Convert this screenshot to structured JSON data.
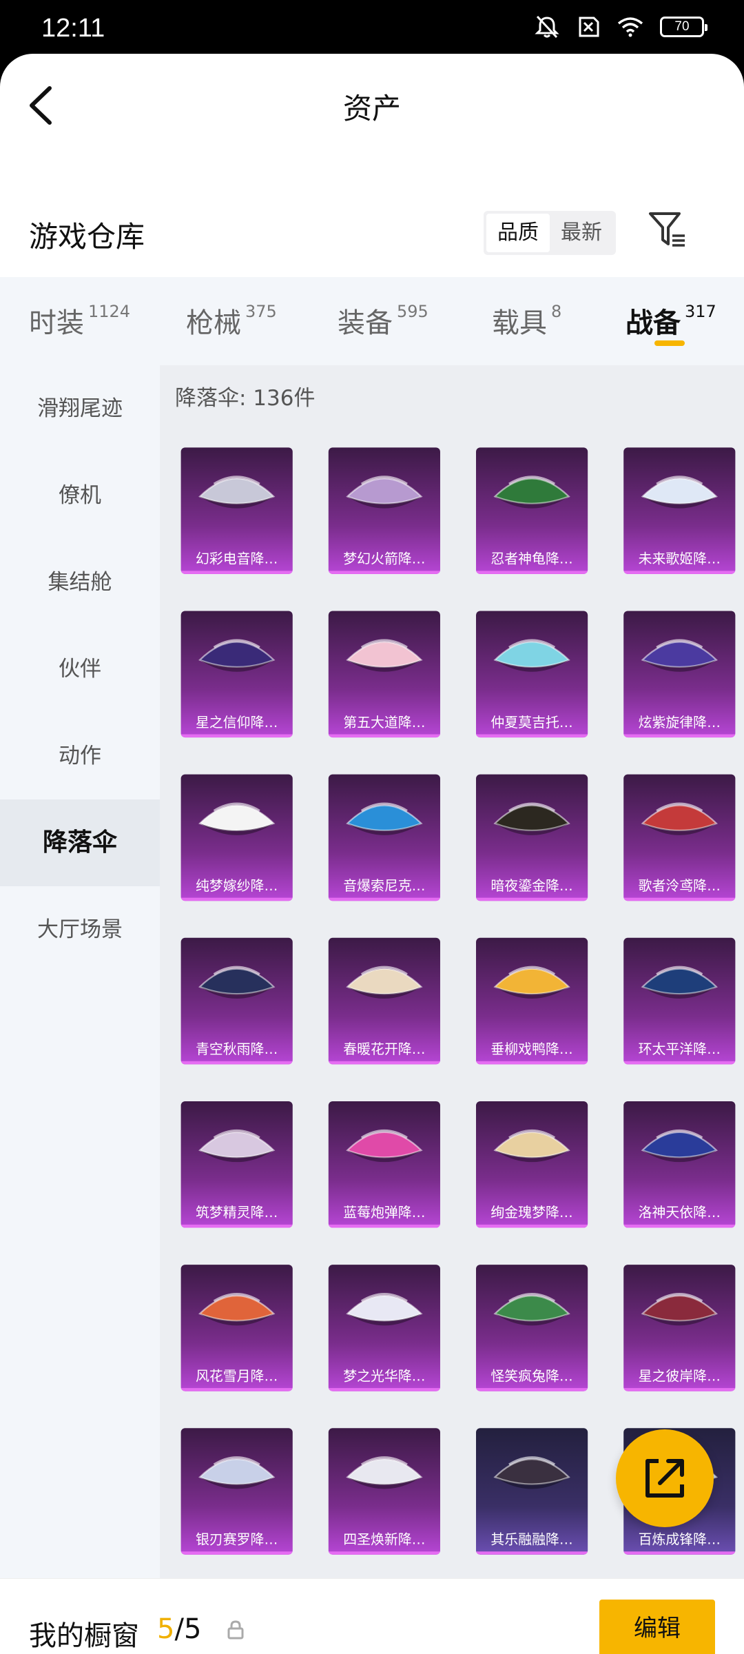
{
  "status": {
    "time": "12:11",
    "battery": "70",
    "icons": [
      "mute-icon",
      "sim-off-icon",
      "wifi-icon",
      "battery-icon"
    ]
  },
  "nav": {
    "title": "资产",
    "back_icon": "chevron-left-icon"
  },
  "warehouse": {
    "title": "游戏仓库",
    "sort_options": [
      "品质",
      "最新"
    ],
    "active_sort": "品质",
    "filter_icon": "filter-icon"
  },
  "tabs": [
    {
      "label": "时装",
      "count": "1124"
    },
    {
      "label": "枪械",
      "count": "375"
    },
    {
      "label": "装备",
      "count": "595"
    },
    {
      "label": "载具",
      "count": "8"
    },
    {
      "label": "战备",
      "count": "317"
    }
  ],
  "active_tab": "战备",
  "sidebar": {
    "items": [
      "滑翔尾迹",
      "僚机",
      "集结舱",
      "伙伴",
      "动作",
      "降落伞",
      "大厅场景"
    ],
    "active": "降落伞"
  },
  "content": {
    "count_label": "降落伞: 136件",
    "items": [
      "幻彩电音降",
      "梦幻火箭降",
      "忍者神龟降",
      "未来歌姬降",
      "星之信仰降",
      "第五大道降",
      "仲夏莫吉托",
      "炫紫旋律降",
      "纯梦嫁纱降",
      "音爆索尼克",
      "暗夜鎏金降",
      "歌者泠鸢降",
      "青空秋雨降",
      "春暖花开降",
      "垂柳戏鸭降",
      "环太平洋降",
      "筑梦精灵降",
      "蓝莓炮弹降",
      "绚金瑰梦降",
      "洛神天依降",
      "风花雪月降",
      "梦之光华降",
      "怪笑疯兔降",
      "星之彼岸降",
      "银刃赛罗降",
      "四圣焕新降",
      "其乐融融降",
      "百炼成锋降"
    ],
    "item_colors": [
      "#c8c8d8",
      "#b79ad0",
      "#2f7a3a",
      "#dfe8f6",
      "#3a2a78",
      "#f2c3d2",
      "#7fd4e4",
      "#4b3aa0",
      "#f4f4f4",
      "#2a8fd8",
      "#2c2820",
      "#c43a3a",
      "#27305c",
      "#ead9c0",
      "#f2b436",
      "#1e3e7a",
      "#d8c8e0",
      "#e04aa8",
      "#e8d0a0",
      "#2a3c9a",
      "#e0643a",
      "#e8e8f4",
      "#3c8a4a",
      "#8a2a3c",
      "#c8d0e8",
      "#e8e8f0",
      "#3a3040",
      "#a8c0e0"
    ]
  },
  "fab": {
    "icon": "share-external-icon"
  },
  "bottom": {
    "showcase_label": "我的橱窗",
    "showcase_current": "5",
    "showcase_sep": "/",
    "showcase_total": "5",
    "lock_icon": "lock-icon",
    "edit_label": "编辑"
  },
  "colors": {
    "accent": "#f7b500",
    "card_purple": "#7a2d8c"
  }
}
